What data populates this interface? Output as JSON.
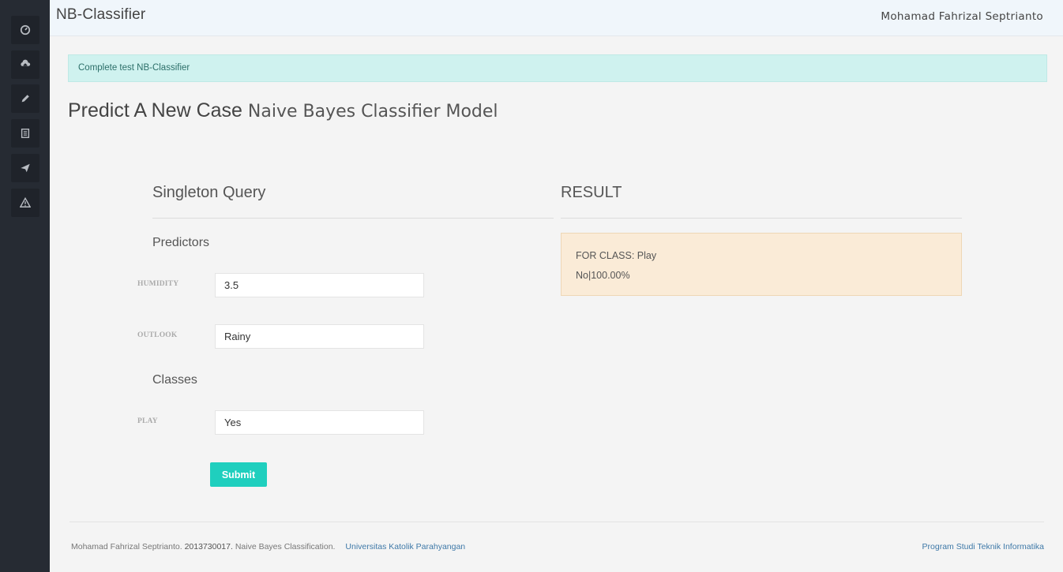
{
  "app": {
    "brand": "NB-Classifier",
    "user": "Mohamad Fahrizal Septrianto"
  },
  "sidebar": {
    "items": [
      {
        "icon": "dashboard-icon"
      },
      {
        "icon": "upload-icon"
      },
      {
        "icon": "pencil-icon"
      },
      {
        "icon": "document-icon"
      },
      {
        "icon": "send-icon"
      },
      {
        "icon": "warning-icon"
      }
    ]
  },
  "alert": {
    "text": "Complete test NB-Classifier"
  },
  "page": {
    "title": "Predict A New Case",
    "subtitle": "Naive Bayes Classifier Model"
  },
  "query": {
    "title": "Singleton Query",
    "predictors_title": "Predictors",
    "classes_title": "Classes",
    "fields": [
      {
        "label": "HUMIDITY",
        "value": "3.5"
      },
      {
        "label": "OUTLOOK",
        "value": "Rainy"
      }
    ],
    "class_field": {
      "label": "PLAY",
      "value": "Yes"
    },
    "submit_label": "Submit"
  },
  "result": {
    "title": "RESULT",
    "class_line": "FOR CLASS: Play",
    "value_line": "No|100.00%"
  },
  "footer": {
    "author": "Mohamad Fahrizal Septrianto.",
    "student_id": "2013730017.",
    "description": "Naive Bayes Classification.",
    "university": "Universitas Katolik Parahyangan",
    "program": "Program Studi Teknik Informatika"
  },
  "colors": {
    "sidebar_bg": "#262b33",
    "accent": "#1fcfbe",
    "alert_bg": "#cff2ef",
    "result_bg": "#faebd7",
    "link": "#3f79a8"
  }
}
